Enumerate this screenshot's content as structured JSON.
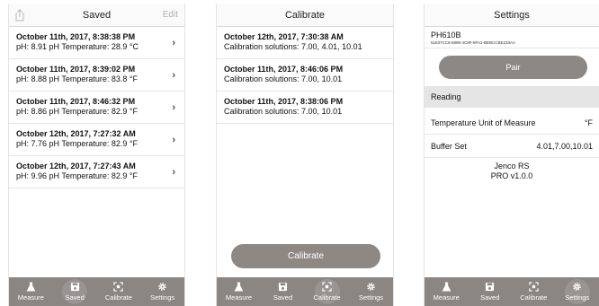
{
  "tabs": [
    {
      "label": "Measure",
      "icon": "flask-icon"
    },
    {
      "label": "Saved",
      "icon": "floppy-disk-icon"
    },
    {
      "label": "Calibrate",
      "icon": "calibrate-target-icon"
    },
    {
      "label": "Settings",
      "icon": "gear-icon"
    }
  ],
  "saved": {
    "title": "Saved",
    "edit_label": "Edit",
    "items": [
      {
        "title": "October 11th, 2017, 8:38:38 PM",
        "sub": "pH: 8.91 pH  Temperature: 28.9 °C"
      },
      {
        "title": "October 11th, 2017, 8:39:02 PM",
        "sub": "pH: 8.88 pH  Temperature: 83.8 °F"
      },
      {
        "title": "October 11th, 2017, 8:46:32 PM",
        "sub": "pH: 8.86 pH  Temperature: 82.9 °F"
      },
      {
        "title": "October 12th, 2017, 7:27:32 AM",
        "sub": "pH: 7.76 pH  Temperature: 82.9 °F"
      },
      {
        "title": "October 12th, 2017, 7:27:43 AM",
        "sub": "pH: 9.96 pH  Temperature: 82.9 °F"
      }
    ]
  },
  "calibrate": {
    "title": "Calibrate",
    "items": [
      {
        "title": "October 12th, 2017, 7:30:38 AM",
        "sub": "Calibration solutions: 7.00, 4.01, 10.01"
      },
      {
        "title": "October 11th, 2017, 8:46:06 PM",
        "sub": "Calibration solutions: 7.00, 10.01"
      },
      {
        "title": "October 11th, 2017, 8:38:06 PM",
        "sub": "Calibration solutions: 7.00, 10.01"
      }
    ],
    "button_label": "Calibrate"
  },
  "settings": {
    "title": "Settings",
    "device_name": "PH610B",
    "device_id": "51837CC6-6898-4C8F-8FA1-BEBCCBE233AA",
    "pair_label": "Pair",
    "section": "Reading",
    "temp_unit_label": "Temperature Unit of Measure",
    "temp_unit_value": "°F",
    "buffer_label": "Buffer Set",
    "buffer_value": "4.01,7.00,10.01",
    "brand": "Jenco RS",
    "version": "PRO v1.0.0"
  },
  "colors": {
    "tabbar": "#8b8682",
    "button": "#8e8884"
  }
}
